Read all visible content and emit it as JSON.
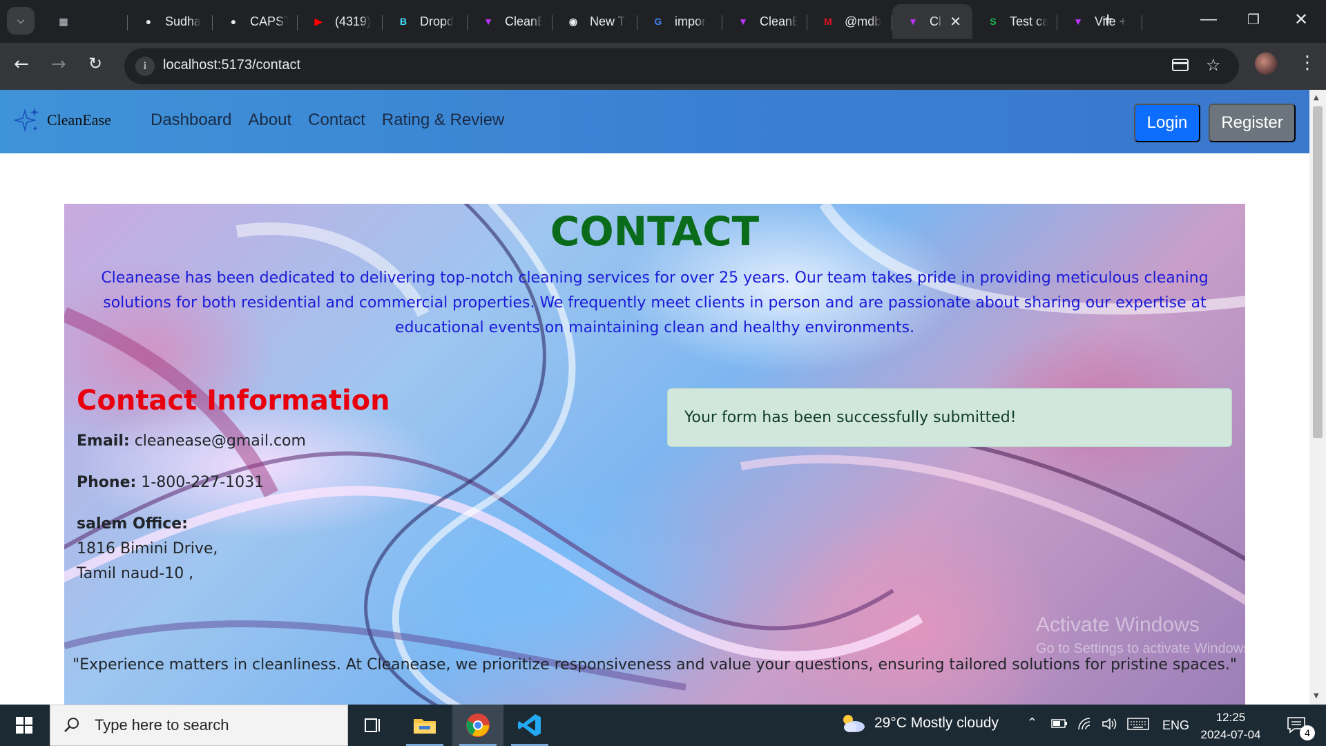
{
  "browser": {
    "tabs": [
      {
        "title": "",
        "icon": "window-icon",
        "color": "#9aa0a6"
      },
      {
        "title": "Sudha",
        "icon": "github-icon",
        "color": "#e8eaed"
      },
      {
        "title": "CAPST",
        "icon": "github-icon",
        "color": "#e8eaed"
      },
      {
        "title": "(4319)",
        "icon": "youtube-icon",
        "color": "#ff0000"
      },
      {
        "title": "Dropd",
        "icon": "react-bootstrap-icon",
        "color": "#41e0fd"
      },
      {
        "title": "CleanE",
        "icon": "vite-icon",
        "color": "#bd34fe"
      },
      {
        "title": "New T",
        "icon": "chrome-icon",
        "color": "#e8eaed"
      },
      {
        "title": "impor",
        "icon": "google-icon",
        "color": "#4285f4"
      },
      {
        "title": "CleanE",
        "icon": "vite-icon",
        "color": "#bd34fe"
      },
      {
        "title": "@mdb",
        "icon": "mdb-icon",
        "color": "#e01020"
      },
      {
        "title": "Cl",
        "icon": "vite-icon",
        "color": "#bd34fe",
        "active": true
      },
      {
        "title": "Test ca",
        "icon": "sheets-icon",
        "color": "#1db954"
      },
      {
        "title": "Vite +",
        "icon": "vite-icon",
        "color": "#bd34fe"
      }
    ],
    "new_tab_label": "+",
    "url": "localhost:5173/contact"
  },
  "app": {
    "brand": "CleanEase",
    "nav_links": [
      "Dashboard",
      "About",
      "Contact",
      "Rating & Review"
    ],
    "login_label": "Login",
    "register_label": "Register",
    "colors": {
      "login": "#0d6efd",
      "register": "#6c757d",
      "title": "#0a6b1a",
      "intro": "#1a1ad8",
      "info_heading": "#e8000f"
    }
  },
  "contact": {
    "title": "CONTACT",
    "intro": "Cleanease has been dedicated to delivering top-notch cleaning services for over 25 years. Our team takes pride in providing meticulous cleaning solutions for both residential and commercial properties. We frequently meet clients in person and are passionate about sharing our expertise at educational events on maintaining clean and healthy environments.",
    "info_heading": "Contact Information",
    "email_label": "Email:",
    "email": "cleanease@gmail.com",
    "phone_label": "Phone:",
    "phone": "1-800-227-1031",
    "office_label": "salem Office:",
    "address_line1": "1816 Bimini Drive,",
    "address_line2": "Tamil naud-10 ,",
    "success_message": "Your form has been successfully submitted!",
    "quote": "\"Experience matters in cleanliness. At Cleanease, we prioritize responsiveness and value your questions, ensuring tailored solutions for pristine spaces.\""
  },
  "watermark": {
    "title": "Activate Windows",
    "subtitle": "Go to Settings to activate Windows."
  },
  "taskbar": {
    "search_placeholder": "Type here to search",
    "weather": "29°C  Mostly cloudy",
    "language": "ENG",
    "time": "12:25",
    "date": "2024-07-04",
    "notification_count": "4"
  }
}
